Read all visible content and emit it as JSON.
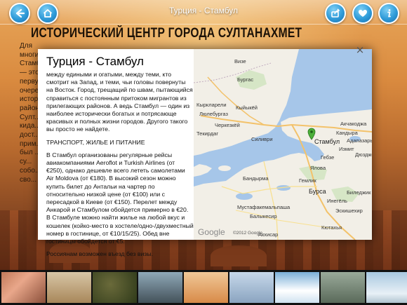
{
  "app": {
    "title": "Турция - Стамбул"
  },
  "article": {
    "heading": "ИСТОРИЧЕСКИЙ ЦЕНТР ГОРОДА СУЛТАНАХМЕТ",
    "intro": "Для многих Стамбул — это в первую очередь исторический район Султ... кида... дост... прим... был ... и су... собо... о сво..."
  },
  "modal": {
    "title": "Турция - Стамбул",
    "paragraphs": [
      "между едиными и огатыми, между теми, кто смотрит на Запад, и теми, чьи головы повернуты на Восток. Город, трещащий по швам, пытающийся справиться с постоянным притоком мигрантов из прилегающих районов. А ведь Стамбул — один из наиболее исторически богатых и потрясающе красивых и полных жизни городов. Другого такого вы просто не найдете.",
      "ТРАНСПОРТ, ЖИЛЬЕ И ПИТАНИЕ",
      "В Стамбул организованы регулярные рейсы авиакомпаниями Aeroflot и Turkish Airlines (от €250), однако дешевле всего лететь самолетами Air Moldova (от €180). В высокий сезон можно купить билет до Антальи на чартер по относительно низкой цене (от €100) или с пересадкой в Киеве (от €150). Перелет между Анкарой и Стамбулом обойдется примерно в  €20. В Стамбуле можно найти жилье на любой вкус и кошелек (койко-место в хостеле/одно-/двухместный номер в гостинице, от €10/15/25). Обед вне гостиницы обойдется от €5.",
      "Россиянам возможен въезд без визы."
    ],
    "close": "×"
  },
  "map": {
    "labels": {
      "vizye": "Визе",
      "burgas": "Бургас",
      "kirklareli": "Кыркларели",
      "luleburgaz": "Люлебургаз",
      "kiyikoy": "Кыйыкёй",
      "cerkezkoy": "Черкезкёй",
      "silivri": "Силиври",
      "istanbul": "Стамбул",
      "kandira": "Кандыра",
      "adapazari": "Адапазары",
      "izmit": "Измит",
      "gebze": "Гебзе",
      "yalova": "Ялова",
      "gemlik": "Гемлик",
      "bursa": "Бурса",
      "bandirma": "Бандырма",
      "mustafakemalpasa": "Мустафакемальпаша",
      "balikesir": "Балыкесир",
      "bilecik": "Биледжик",
      "eskisehir": "Эскишехир",
      "kutahya": "Кютахья",
      "akhisar": "Акхисар",
      "duzce": "Дюздже",
      "tekirdag": "Текирдаг",
      "sakarya": "Акчакоджа",
      "inegol": "Инегёль"
    },
    "google": "Google",
    "copyright": "©2012 Google"
  },
  "colors": {
    "accent": "#2f9bd8",
    "marker": "#4caf3a"
  },
  "icons": {
    "back": "back-arrow-icon",
    "home": "home-icon",
    "share": "share-icon",
    "favorite": "heart-icon",
    "info": "info-icon",
    "close": "close-icon"
  }
}
